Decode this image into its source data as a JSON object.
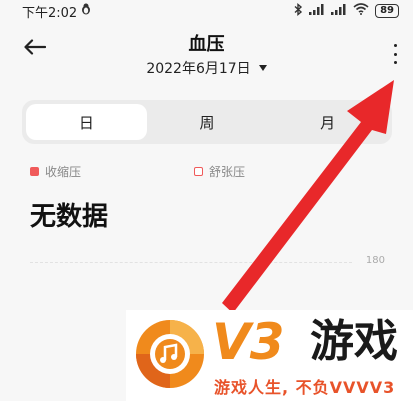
{
  "status_bar": {
    "time": "下午2:02",
    "battery": "89"
  },
  "header": {
    "title": "血压",
    "date": "2022年6月17日"
  },
  "tabs": [
    {
      "label": "日",
      "active": true
    },
    {
      "label": "周",
      "active": false
    },
    {
      "label": "月",
      "active": false
    }
  ],
  "legend": {
    "systolic": {
      "label": "收缩压",
      "color": "#f05a5a"
    },
    "diastolic": {
      "label": "舒张压",
      "color": "#f05a5a"
    }
  },
  "empty_state": "无数据",
  "chart": {
    "y_tick_top": "180"
  },
  "watermark": {
    "brand": "V3",
    "name": "游戏",
    "slogan": "游戏人生, 不负VVVV3"
  },
  "colors": {
    "arrow": "#e8282a",
    "watermark_orange": "#f08a1c"
  }
}
